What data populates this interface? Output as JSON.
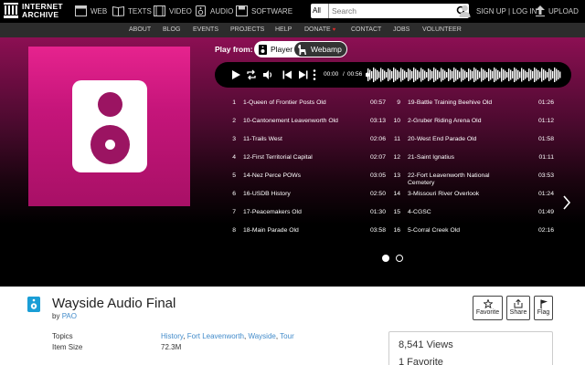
{
  "header": {
    "logo": {
      "line1": "INTERNET",
      "line2": "ARCHIVE"
    },
    "media": [
      {
        "label": "WEB",
        "icon": "web-icon"
      },
      {
        "label": "TEXTS",
        "icon": "book-icon"
      },
      {
        "label": "VIDEO",
        "icon": "film-icon"
      },
      {
        "label": "AUDIO",
        "icon": "speaker-icon"
      },
      {
        "label": "SOFTWARE",
        "icon": "floppy-disk-icon"
      }
    ],
    "search": {
      "scope": "All",
      "placeholder": "Search"
    },
    "auth": "SIGN UP | LOG IN",
    "upload": "UPLOAD"
  },
  "subnav": [
    "ABOUT",
    "BLOG",
    "EVENTS",
    "PROJECTS",
    "HELP",
    "DONATE",
    "CONTACT",
    "JOBS",
    "VOLUNTEER"
  ],
  "player": {
    "play_from": "Play from:",
    "modes": [
      "Player",
      "Webamp"
    ],
    "current_time": "00:00",
    "separator": "/",
    "total_time": "00:56"
  },
  "tracks": [
    {
      "n": "1",
      "title": "1-Queen of Frontier Posts Old",
      "dur": "00:57"
    },
    {
      "n": "2",
      "title": "10-Cantonement Leavenworth Old",
      "dur": "03:13"
    },
    {
      "n": "3",
      "title": "11-Trails West",
      "dur": "02:06"
    },
    {
      "n": "4",
      "title": "12-First Territorial Capital",
      "dur": "02:07"
    },
    {
      "n": "5",
      "title": "14-Nez Perce POWs",
      "dur": "03:05"
    },
    {
      "n": "6",
      "title": "16-USDB History",
      "dur": "02:50"
    },
    {
      "n": "7",
      "title": "17-Peacemakers Old",
      "dur": "01:30"
    },
    {
      "n": "8",
      "title": "18-Main Parade Old",
      "dur": "03:58"
    },
    {
      "n": "9",
      "title": "19-Battle Training Beehive Old",
      "dur": "01:26"
    },
    {
      "n": "10",
      "title": "2-Gruber Riding Arena Old",
      "dur": "01:12"
    },
    {
      "n": "11",
      "title": "20-West End Parade Old",
      "dur": "01:58"
    },
    {
      "n": "12",
      "title": "21-Saint Ignatius",
      "dur": "01:11"
    },
    {
      "n": "13",
      "title": "22-Fort Leavenworth National Cemetery",
      "dur": "03:53"
    },
    {
      "n": "14",
      "title": "3-Missouri River Overlook",
      "dur": "01:24"
    },
    {
      "n": "15",
      "title": "4-CGSC",
      "dur": "01:49"
    },
    {
      "n": "16",
      "title": "5-Corral Creek Old",
      "dur": "02:16"
    }
  ],
  "carousel": {
    "pages": 2,
    "active": 1
  },
  "item": {
    "title": "Wayside Audio Final",
    "by_label": "by",
    "author": "PAO",
    "actions": [
      {
        "label": "Favorite",
        "icon": "star-icon"
      },
      {
        "label": "Share",
        "icon": "share-icon"
      },
      {
        "label": "Flag",
        "icon": "flag-icon"
      }
    ],
    "metadata": {
      "topics_label": "Topics",
      "topics": [
        "History",
        "Fort Leavenworth",
        "Wayside",
        "Tour"
      ],
      "size_label": "Item Size",
      "size": "72.3M"
    },
    "stats": {
      "views": "8,541 Views",
      "favorites": "1 Favorite"
    }
  },
  "colors": {
    "accent_magenta": "#c5157a",
    "link": "#428bca",
    "donate_heart": "#e02b2b"
  }
}
